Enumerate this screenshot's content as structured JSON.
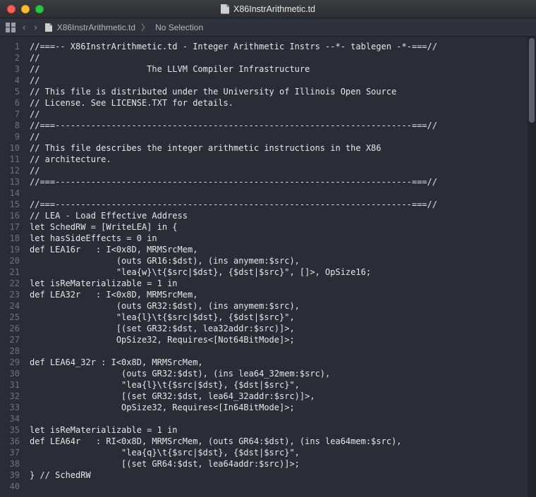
{
  "window": {
    "title": "X86InstrArithmetic.td"
  },
  "pathbar": {
    "back": "‹",
    "forward": "›",
    "file": "X86InstrArithmetic.td",
    "selection": "No Selection",
    "sep": "〉"
  },
  "code": {
    "lines": [
      "//===-- X86InstrArithmetic.td - Integer Arithmetic Instrs --*- tablegen -*-===//",
      "//",
      "//                     The LLVM Compiler Infrastructure",
      "//",
      "// This file is distributed under the University of Illinois Open Source",
      "// License. See LICENSE.TXT for details.",
      "//",
      "//===----------------------------------------------------------------------===//",
      "//",
      "// This file describes the integer arithmetic instructions in the X86",
      "// architecture.",
      "//",
      "//===----------------------------------------------------------------------===//",
      "",
      "//===----------------------------------------------------------------------===//",
      "// LEA - Load Effective Address",
      "let SchedRW = [WriteLEA] in {",
      "let hasSideEffects = 0 in",
      "def LEA16r   : I<0x8D, MRMSrcMem,",
      "                 (outs GR16:$dst), (ins anymem:$src),",
      "                 \"lea{w}\\t{$src|$dst}, {$dst|$src}\", []>, OpSize16;",
      "let isReMaterializable = 1 in",
      "def LEA32r   : I<0x8D, MRMSrcMem,",
      "                 (outs GR32:$dst), (ins anymem:$src),",
      "                 \"lea{l}\\t{$src|$dst}, {$dst|$src}\",",
      "                 [(set GR32:$dst, lea32addr:$src)]>,",
      "                 OpSize32, Requires<[Not64BitMode]>;",
      "",
      "def LEA64_32r : I<0x8D, MRMSrcMem,",
      "                  (outs GR32:$dst), (ins lea64_32mem:$src),",
      "                  \"lea{l}\\t{$src|$dst}, {$dst|$src}\",",
      "                  [(set GR32:$dst, lea64_32addr:$src)]>,",
      "                  OpSize32, Requires<[In64BitMode]>;",
      "",
      "let isReMaterializable = 1 in",
      "def LEA64r   : RI<0x8D, MRMSrcMem, (outs GR64:$dst), (ins lea64mem:$src),",
      "                  \"lea{q}\\t{$src|$dst}, {$dst|$src}\",",
      "                  [(set GR64:$dst, lea64addr:$src)]>;",
      "} // SchedRW",
      ""
    ]
  }
}
